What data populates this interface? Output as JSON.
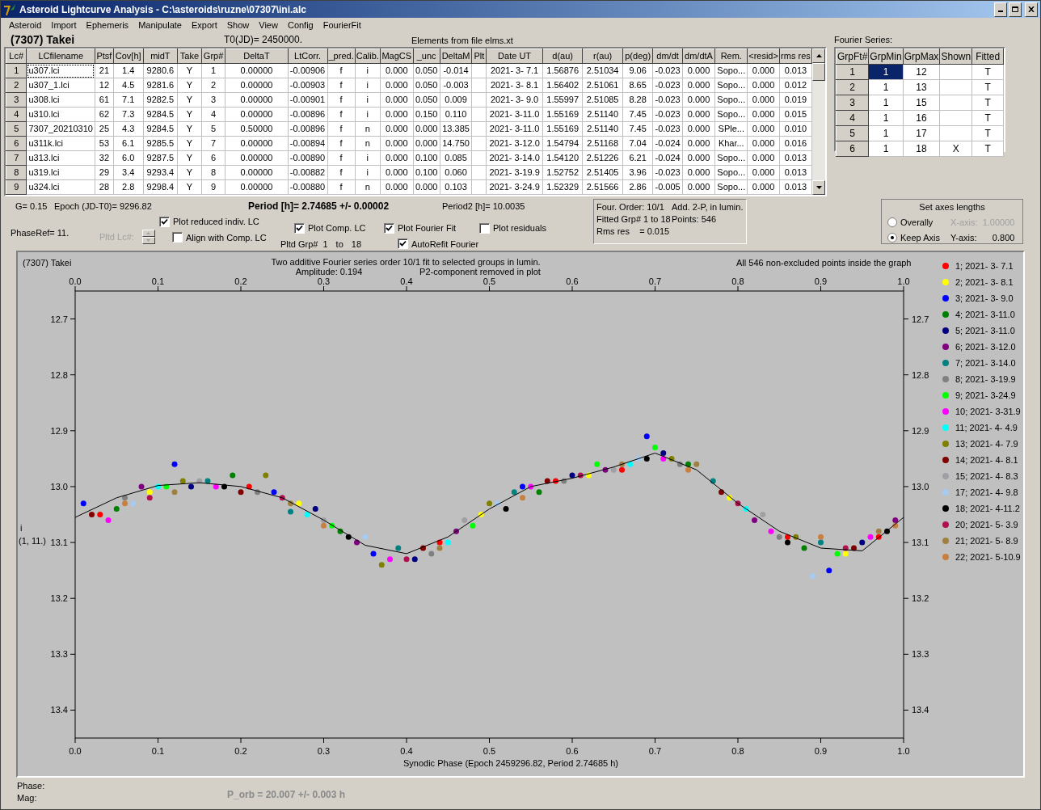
{
  "window": {
    "title": "Asteroid Lightcurve Analysis - C:\\asteroids\\ruzne\\07307\\ini.alc"
  },
  "menu": [
    "Asteroid",
    "Import",
    "Ephemeris",
    "Manipulate",
    "Export",
    "Show",
    "View",
    "Config",
    "FourierFit"
  ],
  "header": {
    "asteroid": "(7307) Takei",
    "t0": "T0(JD)= 2450000.",
    "elements": "Elements from file elms.xt"
  },
  "lc_table": {
    "columns": [
      "Lc#",
      "LCfilename",
      "Ptsf",
      "Cov[h]",
      "midT",
      "Take",
      "Grp#",
      "DeltaT",
      "LtCorr.",
      "_pred.",
      "Calib.",
      "MagCS",
      "_unc",
      "DeltaM",
      "Plt",
      "Date UT",
      "d(au)",
      "r(au)",
      "p(deg)",
      "dm/dt",
      "dm/dtA",
      "Rem.",
      "<resid>",
      "rms res"
    ],
    "rows": [
      {
        "focused": true,
        "cells": [
          "1",
          "u307.lci",
          "21",
          "1.4",
          "9280.6",
          "Y",
          "1",
          "0.00000",
          "-0.00906",
          "f",
          "i",
          "0.000",
          "0.050",
          "-0.014",
          "",
          "2021- 3- 7.1",
          "1.56876",
          "2.51034",
          "9.06",
          "-0.023",
          "0.000",
          "Sopo...",
          "0.000",
          "0.013"
        ]
      },
      {
        "focused": false,
        "cells": [
          "2",
          "u307_1.lci",
          "12",
          "4.5",
          "9281.6",
          "Y",
          "2",
          "0.00000",
          "-0.00903",
          "f",
          "i",
          "0.000",
          "0.050",
          "-0.003",
          "",
          "2021- 3- 8.1",
          "1.56402",
          "2.51061",
          "8.65",
          "-0.023",
          "0.000",
          "Sopo...",
          "0.000",
          "0.012"
        ]
      },
      {
        "focused": false,
        "cells": [
          "3",
          "u308.lci",
          "61",
          "7.1",
          "9282.5",
          "Y",
          "3",
          "0.00000",
          "-0.00901",
          "f",
          "i",
          "0.000",
          "0.050",
          "0.009",
          "",
          "2021- 3- 9.0",
          "1.55997",
          "2.51085",
          "8.28",
          "-0.023",
          "0.000",
          "Sopo...",
          "0.000",
          "0.019"
        ]
      },
      {
        "focused": false,
        "cells": [
          "4",
          "u310.lci",
          "62",
          "7.3",
          "9284.5",
          "Y",
          "4",
          "0.00000",
          "-0.00896",
          "f",
          "i",
          "0.000",
          "0.150",
          "0.110",
          "",
          "2021- 3-11.0",
          "1.55169",
          "2.51140",
          "7.45",
          "-0.023",
          "0.000",
          "Sopo...",
          "0.000",
          "0.015"
        ]
      },
      {
        "focused": false,
        "cells": [
          "5",
          "7307_20210310",
          "25",
          "4.3",
          "9284.5",
          "Y",
          "5",
          "0.50000",
          "-0.00896",
          "f",
          "n",
          "0.000",
          "0.000",
          "13.385",
          "",
          "2021- 3-11.0",
          "1.55169",
          "2.51140",
          "7.45",
          "-0.023",
          "0.000",
          "SPle...",
          "0.000",
          "0.010"
        ]
      },
      {
        "focused": false,
        "cells": [
          "6",
          "u311k.lci",
          "53",
          "6.1",
          "9285.5",
          "Y",
          "7",
          "0.00000",
          "-0.00894",
          "f",
          "n",
          "0.000",
          "0.000",
          "14.750",
          "",
          "2021- 3-12.0",
          "1.54794",
          "2.51168",
          "7.04",
          "-0.024",
          "0.000",
          "Khar...",
          "0.000",
          "0.016"
        ]
      },
      {
        "focused": false,
        "cells": [
          "7",
          "u313.lci",
          "32",
          "6.0",
          "9287.5",
          "Y",
          "6",
          "0.00000",
          "-0.00890",
          "f",
          "i",
          "0.000",
          "0.100",
          "0.085",
          "",
          "2021- 3-14.0",
          "1.54120",
          "2.51226",
          "6.21",
          "-0.024",
          "0.000",
          "Sopo...",
          "0.000",
          "0.013"
        ]
      },
      {
        "focused": false,
        "cells": [
          "8",
          "u319.lci",
          "29",
          "3.4",
          "9293.4",
          "Y",
          "8",
          "0.00000",
          "-0.00882",
          "f",
          "i",
          "0.000",
          "0.100",
          "0.060",
          "",
          "2021- 3-19.9",
          "1.52752",
          "2.51405",
          "3.96",
          "-0.023",
          "0.000",
          "Sopo...",
          "0.000",
          "0.013"
        ]
      },
      {
        "focused": false,
        "cells": [
          "9",
          "u324.lci",
          "28",
          "2.8",
          "9298.4",
          "Y",
          "9",
          "0.00000",
          "-0.00880",
          "f",
          "n",
          "0.000",
          "0.000",
          "0.103",
          "",
          "2021- 3-24.9",
          "1.52329",
          "2.51566",
          "2.86",
          "-0.005",
          "0.000",
          "Sopo...",
          "0.000",
          "0.013"
        ]
      }
    ]
  },
  "fourier": {
    "title": "Fourier Series:",
    "columns": [
      "GrpFt#",
      "GrpMin",
      "GrpMax",
      "Shown",
      "Fitted"
    ],
    "rows": [
      {
        "cells": [
          "1",
          "1",
          "12",
          "",
          "T"
        ],
        "selected": true
      },
      {
        "cells": [
          "2",
          "1",
          "13",
          "",
          "T"
        ],
        "selected": false
      },
      {
        "cells": [
          "3",
          "1",
          "15",
          "",
          "T"
        ],
        "selected": false
      },
      {
        "cells": [
          "4",
          "1",
          "16",
          "",
          "T"
        ],
        "selected": false
      },
      {
        "cells": [
          "5",
          "1",
          "17",
          "",
          "T"
        ],
        "selected": false
      },
      {
        "cells": [
          "6",
          "1",
          "18",
          "X",
          "T"
        ],
        "selected": false
      }
    ]
  },
  "params": {
    "g": "G= 0.15",
    "epoch": "Epoch (JD-T0)= 9296.82",
    "period": "Period [h]= 2.74685 +/- 0.00002",
    "period2": "Period2 [h]= 10.0035",
    "phase_ref": "PhaseRef= 11.",
    "pltd_lc": {
      "label": "Pltd Lc#:",
      "disabled": true
    }
  },
  "options": [
    {
      "label": "Plot reduced indiv. LC",
      "checked": true
    },
    {
      "label": "Align with Comp. LC",
      "checked": false
    },
    {
      "label": "Plot Comp. LC",
      "checked": true
    },
    {
      "label": "Plot Fourier Fit",
      "checked": true
    },
    {
      "label": "AutoRefit Fourier",
      "checked": true
    },
    {
      "label": "Plot residuals",
      "checked": false
    }
  ],
  "pltd_grp": {
    "label": "Pltd Grp#",
    "from": "1",
    "to_label": "to",
    "to": "18"
  },
  "fit_summary": [
    "Four. Order: 10/1",
    "Add. 2-P, in lumin.",
    "Fitted Grp# 1 to 18",
    "Points: 546",
    "Rms res    = 0.015"
  ],
  "axes": {
    "title": "Set axes lengths",
    "options": [
      {
        "label": "Overally",
        "selected": false
      },
      {
        "label": "Keep Axis",
        "selected": true
      }
    ],
    "x_axis": {
      "label": "X-axis:",
      "value": "1.00000",
      "disabled": true
    },
    "y_axis": {
      "label": "Y-axis:",
      "value": "0.800",
      "disabled": false
    }
  },
  "plot": {
    "top_tick_labels": [
      "0.0",
      "0.1",
      "0.2",
      "0.3",
      "0.4",
      "0.5",
      "0.6",
      "0.7",
      "0.8",
      "0.9",
      "1.0"
    ],
    "right_tick_labels": [
      "12.7",
      "12.8",
      "12.9",
      "13.0",
      "13.1",
      "13.2",
      "13.3",
      "13.4"
    ],
    "chart_data": {
      "type": "scatter",
      "title": "Two additive Fourier series order 10/1 fit to selected groups in lumin.",
      "xlabel": "Synodic Phase (Epoch 2459296.82, Period 2.74685 h)",
      "ylabel": "i",
      "legend": "right",
      "xlim": [
        0,
        1
      ],
      "ylim": [
        13.45,
        12.65
      ],
      "xticks": [
        {
          "value": 0,
          "label": "0.0"
        },
        0.1,
        0.2,
        0.3,
        0.4,
        0.5,
        0.6,
        0.7,
        0.8,
        0.9,
        {
          "value": 1,
          "label": "1.0"
        }
      ],
      "yticks": [
        12.7,
        12.8,
        12.9,
        {
          "value": 13,
          "label": "13.0"
        },
        13.1,
        13.2,
        13.3,
        13.4
      ],
      "annotations": [
        "(7307) Takei",
        "Amplitude: 0.194",
        "P2-component removed in plot",
        "All 546 non-excluded points inside the graph",
        "(1, 11.)"
      ],
      "series": [
        {
          "type": "line",
          "color": "#000000",
          "x": [
            0,
            0.05,
            0.1,
            0.15,
            0.2,
            0.25,
            0.3,
            0.35,
            0.4,
            0.45,
            0.5,
            0.55,
            0.6,
            0.65,
            0.7,
            0.75,
            0.8,
            0.85,
            0.9,
            0.95,
            1
          ],
          "values": [
            13.055,
            13.02,
            12.998,
            12.993,
            13.0,
            13.02,
            13.06,
            13.105,
            13.12,
            13.09,
            13.04,
            13.0,
            12.985,
            12.965,
            12.94,
            12.97,
            13.03,
            13.08,
            13.11,
            13.115,
            13.055
          ]
        },
        {
          "name": "1; 2021- 3- 7.1",
          "color": "#ff0000",
          "x": [
            0.03,
            0.21,
            0.44,
            0.58,
            0.66,
            0.86,
            0.97
          ],
          "values": [
            13.05,
            13.0,
            13.1,
            12.99,
            12.97,
            13.09,
            13.09
          ]
        },
        {
          "name": "2; 2021- 3- 8.1",
          "color": "#ffff00",
          "x": [
            0.09,
            0.27,
            0.49,
            0.62,
            0.79,
            0.93
          ],
          "values": [
            13.01,
            13.03,
            13.05,
            12.98,
            13.02,
            13.12
          ]
        },
        {
          "name": "3; 2021- 3- 9.0",
          "color": "#0000ff",
          "x": [
            0.01,
            0.12,
            0.24,
            0.36,
            0.54,
            0.69,
            0.91
          ],
          "values": [
            13.03,
            12.96,
            13.01,
            13.12,
            13.0,
            12.91,
            13.15
          ]
        },
        {
          "name": "4; 2021- 3-11.0",
          "color": "#008000",
          "x": [
            0.05,
            0.19,
            0.32,
            0.56,
            0.74,
            0.88
          ],
          "values": [
            13.04,
            12.98,
            13.08,
            13.01,
            12.96,
            13.11
          ]
        },
        {
          "name": "5; 2021- 3-11.0",
          "color": "#000080",
          "x": [
            0.14,
            0.29,
            0.41,
            0.6,
            0.71,
            0.95
          ],
          "values": [
            13.0,
            13.04,
            13.13,
            12.98,
            12.94,
            13.1
          ]
        },
        {
          "name": "6; 2021- 3-12.0",
          "color": "#800080",
          "x": [
            0.08,
            0.34,
            0.46,
            0.64,
            0.82,
            0.99
          ],
          "values": [
            13.0,
            13.1,
            13.08,
            12.97,
            13.06,
            13.06
          ]
        },
        {
          "name": "7; 2021- 3-14.0",
          "color": "#008080",
          "x": [
            0.16,
            0.26,
            0.39,
            0.53,
            0.77,
            0.9
          ],
          "values": [
            12.99,
            13.045,
            13.11,
            13.01,
            12.99,
            13.1
          ]
        },
        {
          "name": "8; 2021- 3-19.9",
          "color": "#808080",
          "x": [
            0.06,
            0.22,
            0.43,
            0.59,
            0.73,
            0.85
          ],
          "values": [
            13.02,
            13.01,
            13.12,
            12.99,
            12.96,
            13.09
          ]
        },
        {
          "name": "9; 2021- 3-24.9",
          "color": "#00ff00",
          "x": [
            0.11,
            0.31,
            0.48,
            0.63,
            0.7,
            0.92
          ],
          "values": [
            13.0,
            13.07,
            13.07,
            12.96,
            12.93,
            13.12
          ]
        },
        {
          "name": "10; 2021- 3-31.9",
          "color": "#ff00ff",
          "x": [
            0.04,
            0.17,
            0.38,
            0.55,
            0.71,
            0.84,
            0.96
          ],
          "values": [
            13.06,
            13.0,
            13.13,
            13.0,
            12.95,
            13.08,
            13.09
          ]
        },
        {
          "name": "11; 2021- 4- 4.9",
          "color": "#00ffff",
          "x": [
            0.1,
            0.28,
            0.45,
            0.67,
            0.81
          ],
          "values": [
            13.0,
            13.05,
            13.1,
            12.96,
            13.04
          ]
        },
        {
          "name": "13; 2021- 4- 7.9",
          "color": "#808000",
          "x": [
            0.13,
            0.23,
            0.37,
            0.5,
            0.72,
            0.87
          ],
          "values": [
            12.99,
            12.98,
            13.14,
            13.03,
            12.95,
            13.09
          ]
        },
        {
          "name": "14; 2021- 4- 8.1",
          "color": "#800000",
          "x": [
            0.02,
            0.2,
            0.42,
            0.57,
            0.78,
            0.94
          ],
          "values": [
            13.05,
            13.01,
            13.11,
            12.99,
            13.01,
            13.11
          ]
        },
        {
          "name": "15; 2021- 4- 8.3",
          "color": "#a0a0a4",
          "x": [
            0.15,
            0.3,
            0.47,
            0.65,
            0.83
          ],
          "values": [
            12.99,
            13.06,
            13.06,
            12.97,
            13.05
          ]
        },
        {
          "name": "17; 2021- 4- 9.8",
          "color": "#a6caf0",
          "x": [
            0.07,
            0.35,
            0.51,
            0.68,
            0.89
          ],
          "values": [
            13.03,
            13.09,
            13.03,
            12.95,
            13.16
          ]
        },
        {
          "name": "18; 2021- 4-11.2",
          "color": "#000000",
          "x": [
            0.18,
            0.33,
            0.52,
            0.69,
            0.86,
            0.98
          ],
          "values": [
            13.0,
            13.09,
            13.04,
            12.95,
            13.1,
            13.08
          ]
        },
        {
          "name": "20; 2021- 5- 3.9",
          "color": "#b01050",
          "x": [
            0.09,
            0.25,
            0.4,
            0.61,
            0.8,
            0.93
          ],
          "values": [
            13.02,
            13.02,
            13.13,
            12.98,
            13.03,
            13.11
          ]
        },
        {
          "name": "21; 2021- 5- 8.9",
          "color": "#a08040",
          "x": [
            0.12,
            0.26,
            0.44,
            0.66,
            0.75,
            0.97
          ],
          "values": [
            13.01,
            13.03,
            13.11,
            12.96,
            12.96,
            13.08
          ]
        },
        {
          "name": "22; 2021- 5-10.9",
          "color": "#c88040",
          "x": [
            0.06,
            0.3,
            0.54,
            0.74,
            0.9,
            0.99
          ],
          "values": [
            13.03,
            13.07,
            13.02,
            12.97,
            13.09,
            13.07
          ]
        }
      ]
    }
  },
  "status": {
    "phase_label": "Phase:",
    "mag_label": "Mag:",
    "p_orb": "P_orb = 20.007 +/- 0.003 h"
  }
}
